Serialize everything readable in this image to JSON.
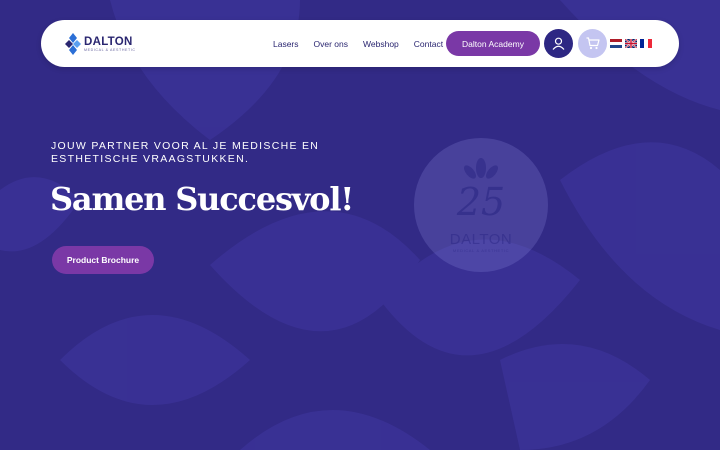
{
  "brand": {
    "name": "DALTON",
    "tagline": "MEDICAL & AESTHETIC",
    "colors": {
      "background": "#322a86",
      "primary": "#7a38a6",
      "navy": "#2d2783",
      "cart": "#c4c5f1"
    }
  },
  "nav": {
    "links": [
      "Lasers",
      "Over ons",
      "Webshop",
      "Contact"
    ],
    "academy_label": "Dalton Academy",
    "account_icon": "user-icon",
    "cart_icon": "cart-icon",
    "languages": [
      "NL",
      "EN",
      "FR"
    ]
  },
  "hero": {
    "subtitle": "JOUW PARTNER VOOR AL JE MEDISCHE EN ESTHETISCHE VRAAGSTUKKEN.",
    "title": "Samen Succesvol!",
    "button_label": "Product Brochure"
  },
  "badge": {
    "number": "25",
    "name": "DALTON",
    "tagline": "MEDICAL & AESTHETIC"
  }
}
